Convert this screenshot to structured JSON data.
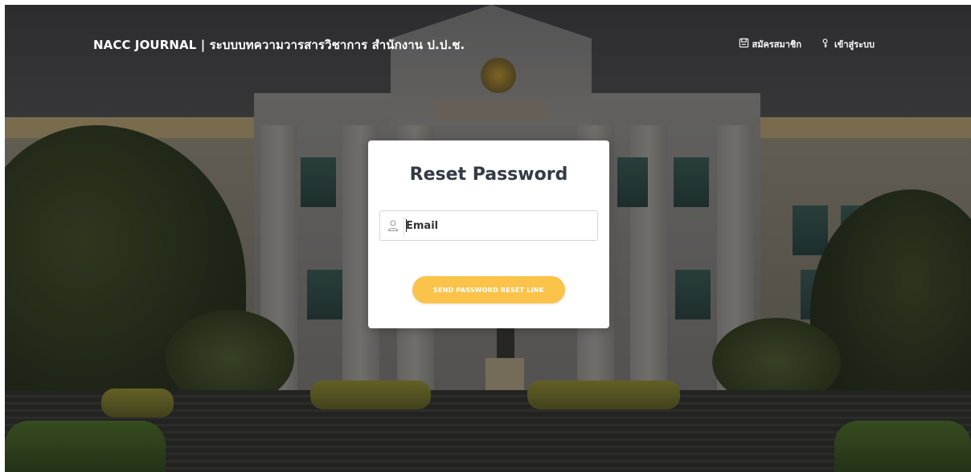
{
  "header": {
    "brand": "NACC JOURNAL | ระบบบทความวารสารวิชาการ สำนักงาน ป.ป.ช.",
    "nav": [
      {
        "label": "สมัครสมาชิก",
        "icon": "register-icon"
      },
      {
        "label": "เข้าสู่ระบบ",
        "icon": "login-icon"
      }
    ]
  },
  "reset_card": {
    "title": "Reset Password",
    "email_field": {
      "placeholder": "Email",
      "value": "",
      "icon": "user-icon"
    },
    "submit_label": "SEND PASSWORD RESET LINK"
  },
  "colors": {
    "accent_button": "#fbc34a",
    "title_text": "#333a44",
    "header_text": "#ffffff"
  }
}
